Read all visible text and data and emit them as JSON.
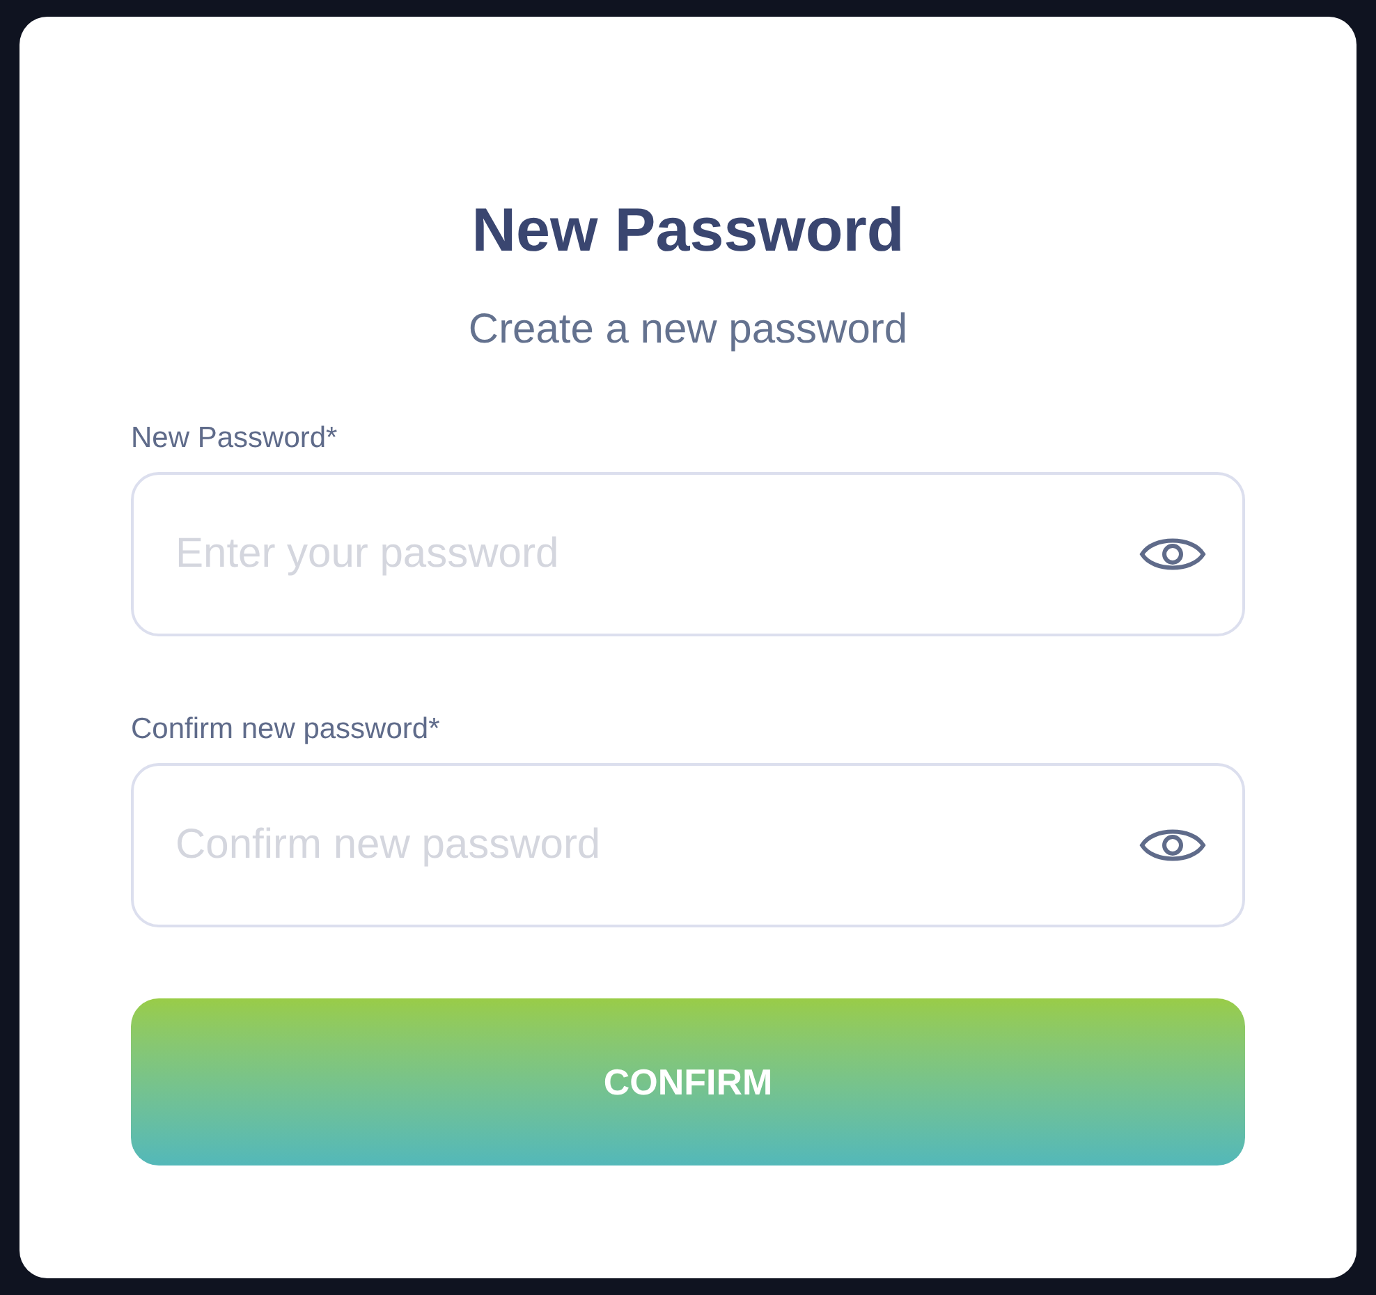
{
  "title": "New Password",
  "subtitle": "Create a new password",
  "fields": [
    {
      "label": "New Password*",
      "placeholder": "Enter your password"
    },
    {
      "label": "Confirm new password*",
      "placeholder": "Confirm new password"
    }
  ],
  "button": "CONFIRM"
}
